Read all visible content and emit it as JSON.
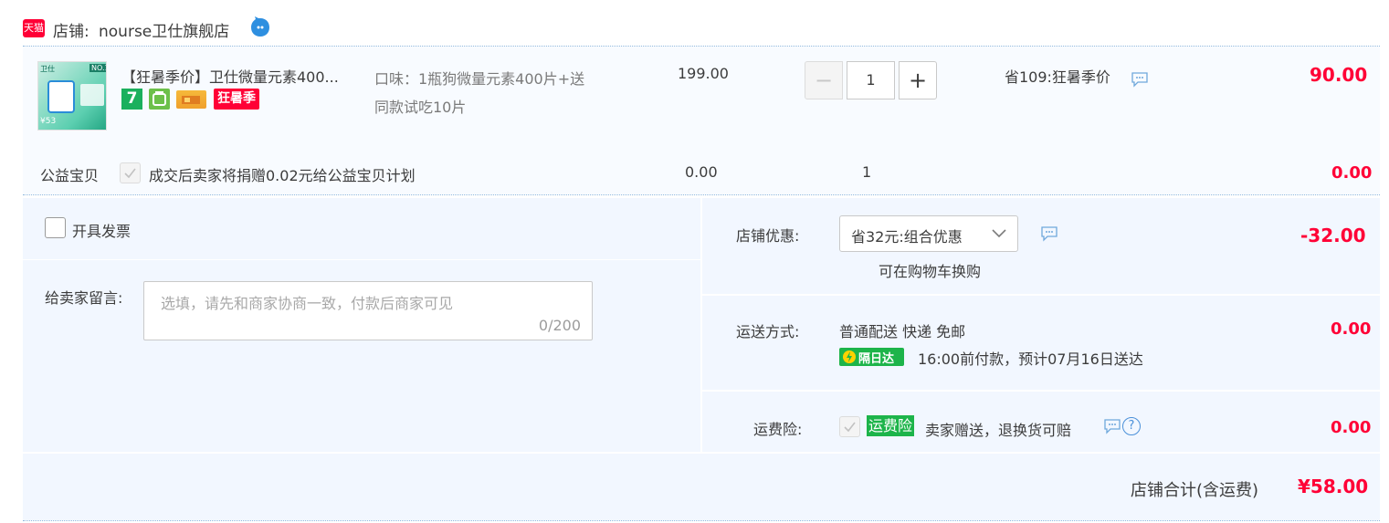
{
  "shop": {
    "tmall_badge": "天猫",
    "label": "店铺:",
    "name": "nourse卫仕旗舰店"
  },
  "product": {
    "title": "【狂暑季价】卫仕微量元素400...",
    "promo_tag": "狂暑季",
    "badge_7": "7",
    "flavor": "口味：1瓶狗微量元素400片+送同款试吃10片",
    "flavor_line1": "口味：1瓶狗微量元素400片+送",
    "flavor_line2": "同款试吃10片",
    "price": "199.00",
    "quantity": "1",
    "discount": "省109:狂暑季价",
    "subtotal": "90.00",
    "thumb_lines": [
      "卫仕",
      "NO.1",
      "¥53"
    ]
  },
  "charity": {
    "label": "公益宝贝",
    "text": "成交后卖家将捐赠0.02元给公益宝贝计划",
    "price": "0.00",
    "quantity": "1",
    "subtotal": "0.00"
  },
  "invoice": {
    "label": "开具发票"
  },
  "message": {
    "label": "给卖家留言:",
    "placeholder": "选填，请先和商家协商一致，付款后商家可见",
    "counter": "0/200"
  },
  "shop_discount": {
    "label": "店铺优惠:",
    "selected": "省32元:组合优惠",
    "note": "可在购物车换购",
    "amount": "-32.00"
  },
  "shipping": {
    "label": "运送方式:",
    "method": "普通配送 快递 免邮",
    "badge": "隔日达",
    "eta": "16:00前付款，预计07月16日送达",
    "amount": "0.00"
  },
  "insurance": {
    "label": "运费险:",
    "badge": "运费险",
    "text": "卖家赠送，退换货可赔",
    "amount": "0.00"
  },
  "total": {
    "label": "店铺合计(含运费)",
    "amount": "¥58.00"
  },
  "colors": {
    "accent": "#ff0036",
    "panel_bg": "#f2f7ff",
    "green": "#1db44a",
    "tmall_red": "#ff0036"
  }
}
